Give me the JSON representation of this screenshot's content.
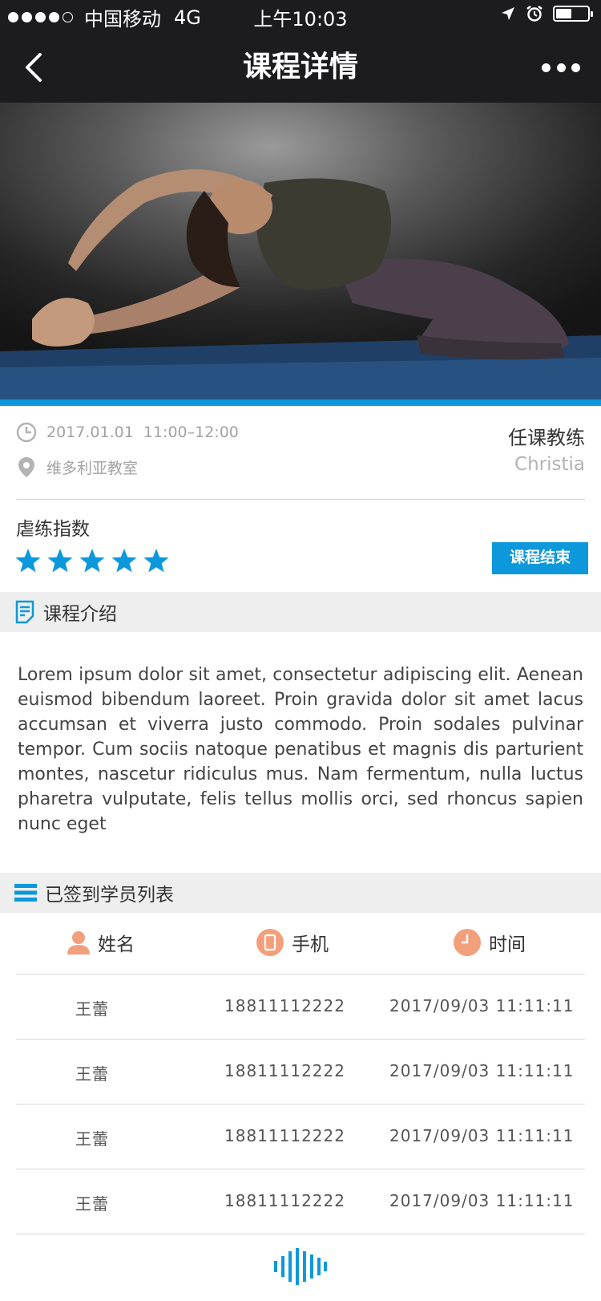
{
  "status_bar": {
    "carrier": "中国移动",
    "network": "4G",
    "time": "上午10:03",
    "battery_level": 0.5
  },
  "nav": {
    "title": "课程详情",
    "back_icon": "chevron-left-icon",
    "more_icon": "more-dots-icon"
  },
  "course": {
    "datetime": "2017.01.01  11:00–12:00",
    "location": "维多利亚教室",
    "teacher_label": "任课教练",
    "teacher_name": "Christia",
    "intensity_label": "虐练指数",
    "intensity_stars": 5,
    "intensity_max": 5,
    "status_button": "课程结束"
  },
  "intro": {
    "title": "课程介绍",
    "text": "Lorem ipsum dolor sit amet, consectetur adipiscing elit. Aenean euismod bibendum laoreet. Proin gravida dolor sit amet lacus accumsan et viverra justo commodo. Proin sodales pulvinar tempor. Cum sociis natoque penatibus et magnis dis parturient montes, nascetur ridiculus mus. Nam fermentum, nulla luctus pharetra vulputate, felis tellus mollis orci, sed rhoncus sapien nunc eget"
  },
  "attendees": {
    "title": "已签到学员列表",
    "columns": [
      "姓名",
      "手机",
      "时间"
    ],
    "rows": [
      {
        "name": "王蕾",
        "phone": "18811112222",
        "time": "2017/09/03 11:11:11"
      },
      {
        "name": "王蕾",
        "phone": "18811112222",
        "time": "2017/09/03 11:11:11"
      },
      {
        "name": "王蕾",
        "phone": "18811112222",
        "time": "2017/09/03 11:11:11"
      },
      {
        "name": "王蕾",
        "phone": "18811112222",
        "time": "2017/09/03 11:11:11"
      }
    ]
  },
  "colors": {
    "accent": "#0d98db",
    "header_bg": "#1c1c1e",
    "icon_orange": "#f2a07b"
  }
}
